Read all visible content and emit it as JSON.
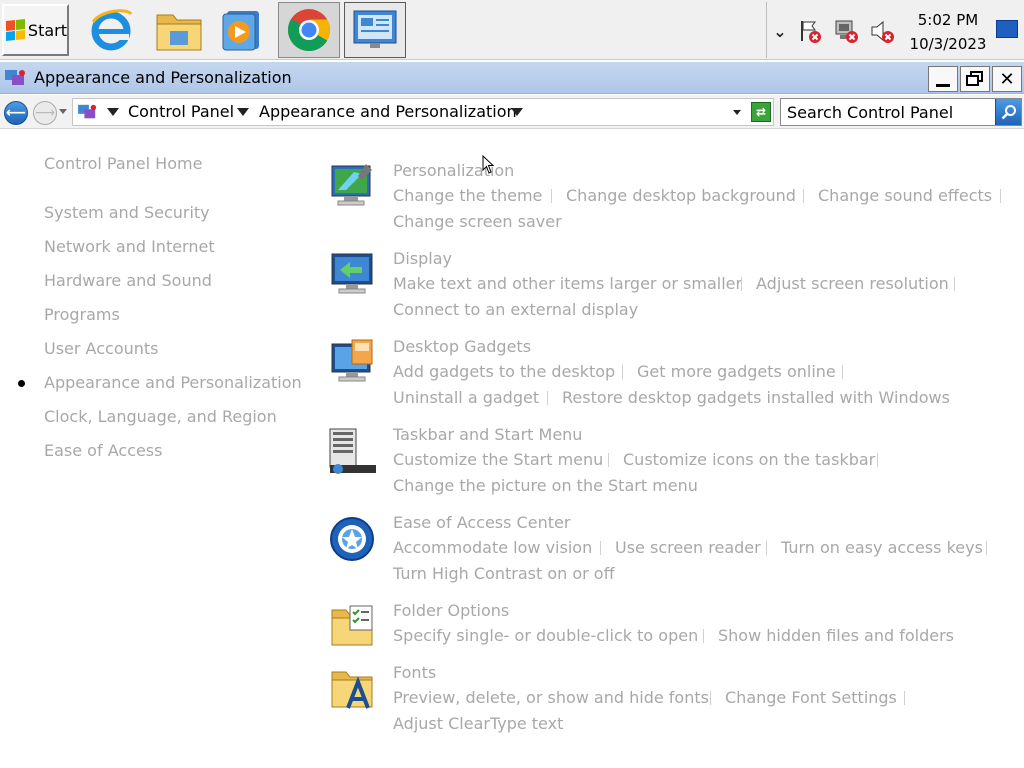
{
  "taskbar": {
    "start_label": "Start",
    "apps": [
      "internet-explorer",
      "file-explorer",
      "media-player",
      "chrome",
      "control-panel"
    ],
    "clock_time": "5:02 PM",
    "clock_date": "10/3/2023"
  },
  "window": {
    "title": "Appearance and Personalization",
    "minimize": "_",
    "close": "✕"
  },
  "address": {
    "crumbs": [
      "Control Panel",
      "Appearance and Personalization"
    ],
    "search_placeholder": "Search Control Panel"
  },
  "left_nav": {
    "home": "Control Panel Home",
    "items": [
      "System and Security",
      "Network and Internet",
      "Hardware and Sound",
      "Programs",
      "User Accounts",
      "Appearance and Personalization",
      "Clock, Language, and Region",
      "Ease of Access"
    ],
    "current_index": 5
  },
  "categories": [
    {
      "title": "Personalization",
      "links": [
        "Change the theme",
        "Change desktop background",
        "Change sound effects",
        "Change screen saver"
      ]
    },
    {
      "title": "Display",
      "links": [
        "Make text and other items larger or smaller",
        "Adjust screen resolution",
        "Connect to an external display"
      ]
    },
    {
      "title": "Desktop Gadgets",
      "links": [
        "Add gadgets to the desktop",
        "Get more gadgets online",
        "Uninstall a gadget",
        "Restore desktop gadgets installed with Windows"
      ]
    },
    {
      "title": "Taskbar and Start Menu",
      "links": [
        "Customize the Start menu",
        "Customize icons on the taskbar",
        "Change the picture on the Start menu"
      ]
    },
    {
      "title": "Ease of Access Center",
      "links": [
        "Accommodate low vision",
        "Use screen reader",
        "Turn on easy access keys",
        "Turn High Contrast on or off"
      ]
    },
    {
      "title": "Folder Options",
      "links": [
        "Specify single- or double-click to open",
        "Show hidden files and folders"
      ]
    },
    {
      "title": "Fonts",
      "links": [
        "Preview, delete, or show and hide fonts",
        "Change Font Settings",
        "Adjust ClearType text"
      ]
    }
  ],
  "colors": {
    "link_text": "#a8a8a8",
    "titlebar": "#b9cfec",
    "accent_blue": "#1e63b8"
  }
}
